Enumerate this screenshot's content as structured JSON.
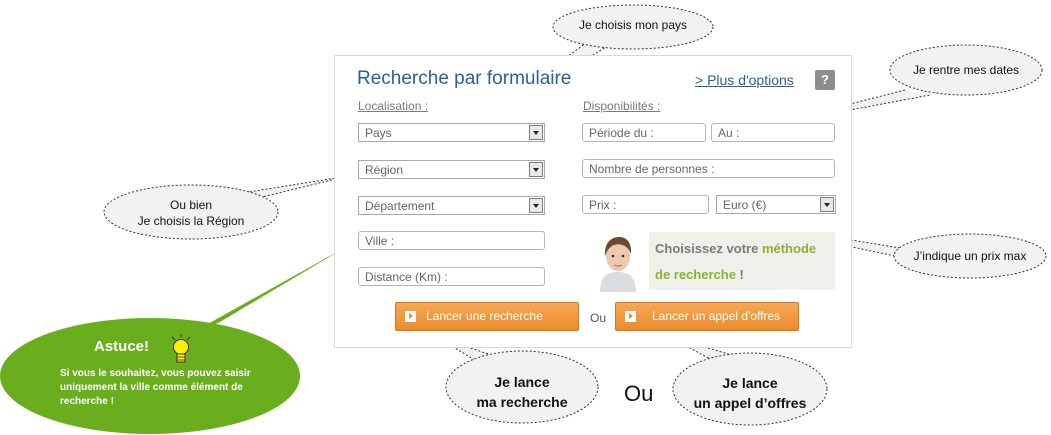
{
  "form": {
    "title": "Recherche par formulaire",
    "more_options": "> Plus d'options",
    "help": "?",
    "localisation_label": "Localisation :",
    "disponibilites_label": "Disponibilités :",
    "pays": "Pays",
    "region": "Région",
    "departement": "Département",
    "ville": "Ville :",
    "distance": "Distance (Km) :",
    "periode": "Période du :",
    "au": "Au :",
    "personnes": "Nombre de personnes :",
    "prix": "Prix :",
    "currency": "Euro (€)",
    "promo_line1_a": "Choisissez votre ",
    "promo_line1_b": "méthode",
    "promo_line2_a": "de recherche",
    "promo_line2_b": " !",
    "search_button": "Lancer une recherche",
    "or_small": "Ou",
    "tender_button": "Lancer un appel d'offres"
  },
  "callouts": {
    "pays": "Je choisis mon pays",
    "dates": "Je rentre mes dates",
    "region_l1": "Ou bien",
    "region_l2": "Je choisis la Région",
    "prix": "J’indique un prix max",
    "search_l1": "Je lance",
    "search_l2": "ma recherche",
    "tender_l1": "Je lance",
    "tender_l2": "un appel d’offres",
    "big_ou": "Ou"
  },
  "tip": {
    "title": "Astuce!",
    "body": "Si vous le souhaitez, vous pouvez saisir uniquement la ville comme élément de recherche !"
  },
  "colors": {
    "title_blue": "#2e5f93",
    "button_orange": "#e98b2c",
    "tip_green": "#6aae1e",
    "promo_green": "#8db033"
  }
}
